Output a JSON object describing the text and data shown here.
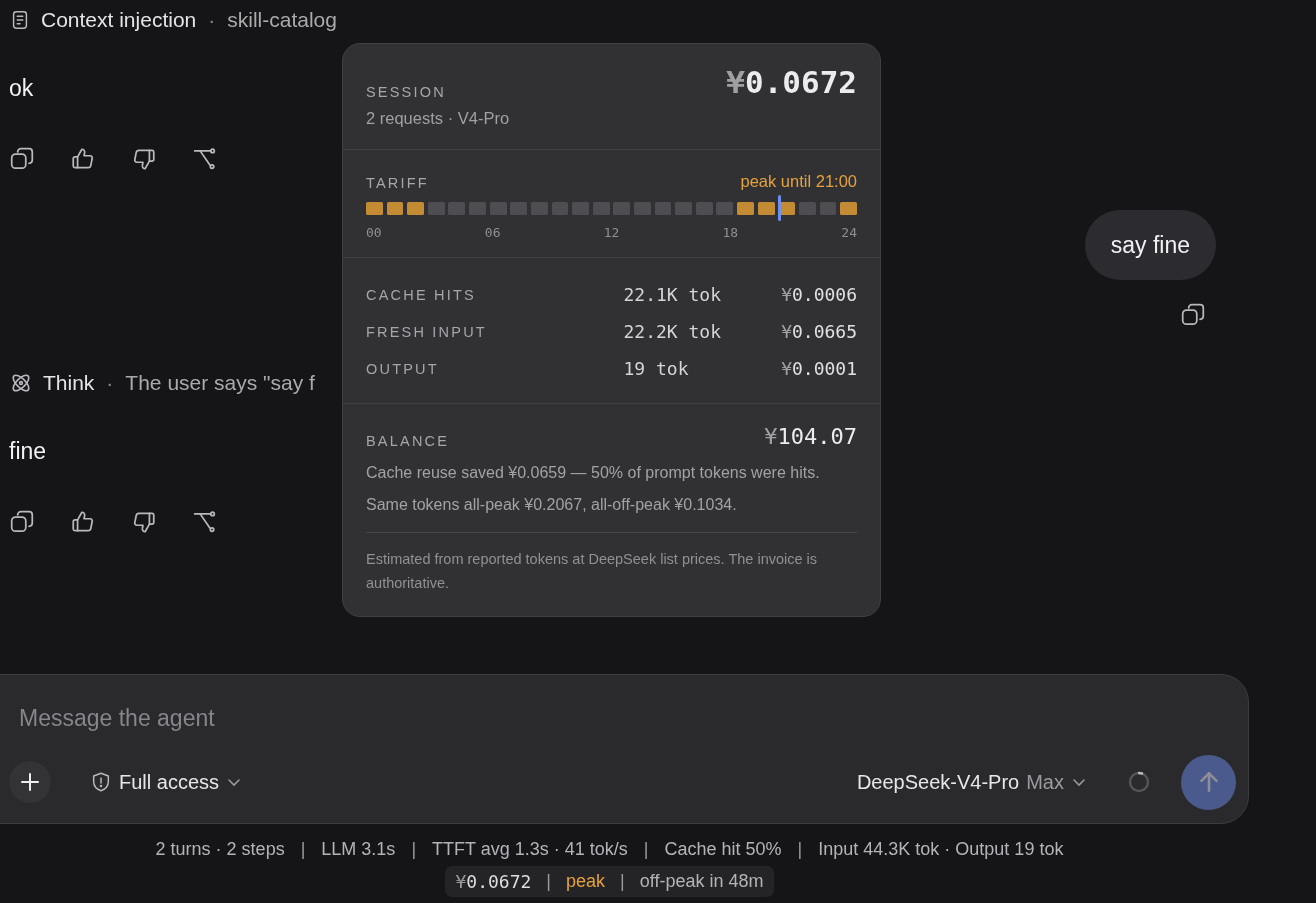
{
  "transcript": [
    {
      "kind": "context",
      "label": "Context injection",
      "separator": "·",
      "detail": "skill-catalog"
    },
    {
      "kind": "assistant",
      "text": "ok"
    },
    {
      "kind": "user",
      "text": "say fine"
    },
    {
      "kind": "thought",
      "label": "Think",
      "separator": "·",
      "detail": "The user says \"say f"
    },
    {
      "kind": "assistant",
      "text": "fine"
    }
  ],
  "cost_popover": {
    "session": {
      "label": "SESSION",
      "currency": "¥",
      "amount": "0.0672",
      "detail": "2 requests · V4-Pro"
    },
    "tariff": {
      "label": "TARIFF",
      "status": "peak until 21:00",
      "now": {
        "level": 0.842
      },
      "ticks": [
        "00",
        "06",
        "12",
        "18",
        "24"
      ],
      "hours": [
        {
          "peak": true
        },
        {
          "peak": true
        },
        {
          "peak": true
        },
        {
          "peak": false
        },
        {
          "peak": false
        },
        {
          "peak": false
        },
        {
          "peak": false
        },
        {
          "peak": false
        },
        {
          "peak": false
        },
        {
          "peak": false
        },
        {
          "peak": false
        },
        {
          "peak": false
        },
        {
          "peak": false
        },
        {
          "peak": false
        },
        {
          "peak": false
        },
        {
          "peak": false
        },
        {
          "peak": false
        },
        {
          "peak": false
        },
        {
          "peak": true
        },
        {
          "peak": true
        },
        {
          "peak": true
        },
        {
          "peak": false
        },
        {
          "peak": false
        },
        {
          "peak": true
        }
      ]
    },
    "breakdown": [
      {
        "label": "CACHE HITS",
        "tokens": "22.1K tok",
        "currency": "¥",
        "cost": "0.0006"
      },
      {
        "label": "FRESH INPUT",
        "tokens": "22.2K tok",
        "currency": "¥",
        "cost": "0.0665"
      },
      {
        "label": "OUTPUT",
        "tokens": "19 tok",
        "currency": "¥",
        "cost": "0.0001"
      }
    ],
    "balance": {
      "label": "BALANCE",
      "currency": "¥",
      "amount": "104.07",
      "notes": [
        "Cache reuse saved ¥0.0659 — 50% of prompt tokens were hits.",
        "Same tokens all-peak ¥0.2067, all-off-peak ¥0.1034."
      ],
      "disclaimer": "Estimated from reported tokens at DeepSeek list prices. The invoice is authoritative."
    }
  },
  "composer": {
    "placeholder": "Message the agent",
    "access": "Full access",
    "model": "DeepSeek-V4-Pro",
    "effort": "Max"
  },
  "stats": {
    "separator": "|",
    "items": [
      "2 turns · 2 steps",
      "LLM 3.1s",
      "TTFT avg 1.3s · 41 tok/s",
      "Cache hit 50%",
      "Input 44.3K tok · Output 19 tok"
    ]
  },
  "cost_pill": {
    "separator": "|",
    "items": [
      {
        "kind": "amount",
        "currency": "¥",
        "text": "0.0672"
      },
      {
        "kind": "peak",
        "text": "peak"
      },
      {
        "kind": "plain",
        "text": "off-peak in 48m"
      }
    ]
  }
}
